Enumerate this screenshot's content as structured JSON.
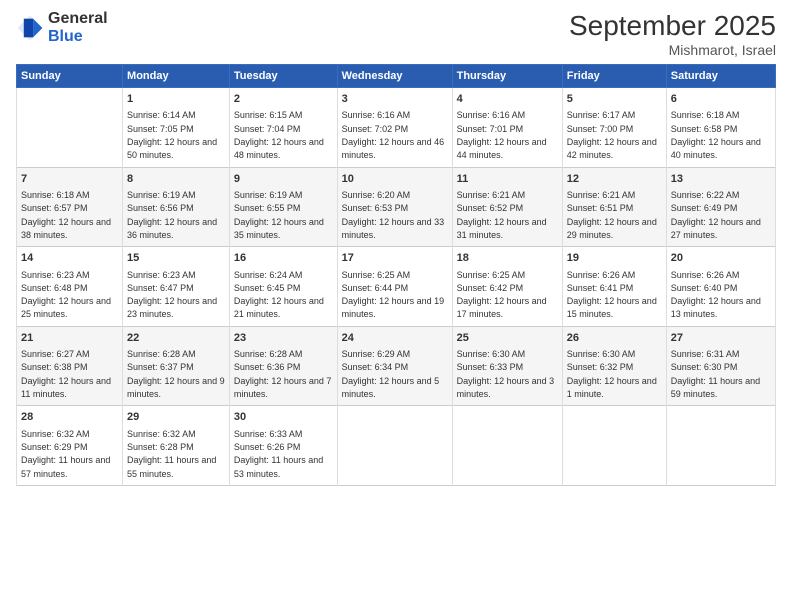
{
  "logo": {
    "general": "General",
    "blue": "Blue"
  },
  "header": {
    "title": "September 2025",
    "subtitle": "Mishmarot, Israel"
  },
  "weekdays": [
    "Sunday",
    "Monday",
    "Tuesday",
    "Wednesday",
    "Thursday",
    "Friday",
    "Saturday"
  ],
  "weeks": [
    [
      {
        "day": "",
        "sunrise": "",
        "sunset": "",
        "daylight": ""
      },
      {
        "day": "1",
        "sunrise": "Sunrise: 6:14 AM",
        "sunset": "Sunset: 7:05 PM",
        "daylight": "Daylight: 12 hours and 50 minutes."
      },
      {
        "day": "2",
        "sunrise": "Sunrise: 6:15 AM",
        "sunset": "Sunset: 7:04 PM",
        "daylight": "Daylight: 12 hours and 48 minutes."
      },
      {
        "day": "3",
        "sunrise": "Sunrise: 6:16 AM",
        "sunset": "Sunset: 7:02 PM",
        "daylight": "Daylight: 12 hours and 46 minutes."
      },
      {
        "day": "4",
        "sunrise": "Sunrise: 6:16 AM",
        "sunset": "Sunset: 7:01 PM",
        "daylight": "Daylight: 12 hours and 44 minutes."
      },
      {
        "day": "5",
        "sunrise": "Sunrise: 6:17 AM",
        "sunset": "Sunset: 7:00 PM",
        "daylight": "Daylight: 12 hours and 42 minutes."
      },
      {
        "day": "6",
        "sunrise": "Sunrise: 6:18 AM",
        "sunset": "Sunset: 6:58 PM",
        "daylight": "Daylight: 12 hours and 40 minutes."
      }
    ],
    [
      {
        "day": "7",
        "sunrise": "Sunrise: 6:18 AM",
        "sunset": "Sunset: 6:57 PM",
        "daylight": "Daylight: 12 hours and 38 minutes."
      },
      {
        "day": "8",
        "sunrise": "Sunrise: 6:19 AM",
        "sunset": "Sunset: 6:56 PM",
        "daylight": "Daylight: 12 hours and 36 minutes."
      },
      {
        "day": "9",
        "sunrise": "Sunrise: 6:19 AM",
        "sunset": "Sunset: 6:55 PM",
        "daylight": "Daylight: 12 hours and 35 minutes."
      },
      {
        "day": "10",
        "sunrise": "Sunrise: 6:20 AM",
        "sunset": "Sunset: 6:53 PM",
        "daylight": "Daylight: 12 hours and 33 minutes."
      },
      {
        "day": "11",
        "sunrise": "Sunrise: 6:21 AM",
        "sunset": "Sunset: 6:52 PM",
        "daylight": "Daylight: 12 hours and 31 minutes."
      },
      {
        "day": "12",
        "sunrise": "Sunrise: 6:21 AM",
        "sunset": "Sunset: 6:51 PM",
        "daylight": "Daylight: 12 hours and 29 minutes."
      },
      {
        "day": "13",
        "sunrise": "Sunrise: 6:22 AM",
        "sunset": "Sunset: 6:49 PM",
        "daylight": "Daylight: 12 hours and 27 minutes."
      }
    ],
    [
      {
        "day": "14",
        "sunrise": "Sunrise: 6:23 AM",
        "sunset": "Sunset: 6:48 PM",
        "daylight": "Daylight: 12 hours and 25 minutes."
      },
      {
        "day": "15",
        "sunrise": "Sunrise: 6:23 AM",
        "sunset": "Sunset: 6:47 PM",
        "daylight": "Daylight: 12 hours and 23 minutes."
      },
      {
        "day": "16",
        "sunrise": "Sunrise: 6:24 AM",
        "sunset": "Sunset: 6:45 PM",
        "daylight": "Daylight: 12 hours and 21 minutes."
      },
      {
        "day": "17",
        "sunrise": "Sunrise: 6:25 AM",
        "sunset": "Sunset: 6:44 PM",
        "daylight": "Daylight: 12 hours and 19 minutes."
      },
      {
        "day": "18",
        "sunrise": "Sunrise: 6:25 AM",
        "sunset": "Sunset: 6:42 PM",
        "daylight": "Daylight: 12 hours and 17 minutes."
      },
      {
        "day": "19",
        "sunrise": "Sunrise: 6:26 AM",
        "sunset": "Sunset: 6:41 PM",
        "daylight": "Daylight: 12 hours and 15 minutes."
      },
      {
        "day": "20",
        "sunrise": "Sunrise: 6:26 AM",
        "sunset": "Sunset: 6:40 PM",
        "daylight": "Daylight: 12 hours and 13 minutes."
      }
    ],
    [
      {
        "day": "21",
        "sunrise": "Sunrise: 6:27 AM",
        "sunset": "Sunset: 6:38 PM",
        "daylight": "Daylight: 12 hours and 11 minutes."
      },
      {
        "day": "22",
        "sunrise": "Sunrise: 6:28 AM",
        "sunset": "Sunset: 6:37 PM",
        "daylight": "Daylight: 12 hours and 9 minutes."
      },
      {
        "day": "23",
        "sunrise": "Sunrise: 6:28 AM",
        "sunset": "Sunset: 6:36 PM",
        "daylight": "Daylight: 12 hours and 7 minutes."
      },
      {
        "day": "24",
        "sunrise": "Sunrise: 6:29 AM",
        "sunset": "Sunset: 6:34 PM",
        "daylight": "Daylight: 12 hours and 5 minutes."
      },
      {
        "day": "25",
        "sunrise": "Sunrise: 6:30 AM",
        "sunset": "Sunset: 6:33 PM",
        "daylight": "Daylight: 12 hours and 3 minutes."
      },
      {
        "day": "26",
        "sunrise": "Sunrise: 6:30 AM",
        "sunset": "Sunset: 6:32 PM",
        "daylight": "Daylight: 12 hours and 1 minute."
      },
      {
        "day": "27",
        "sunrise": "Sunrise: 6:31 AM",
        "sunset": "Sunset: 6:30 PM",
        "daylight": "Daylight: 11 hours and 59 minutes."
      }
    ],
    [
      {
        "day": "28",
        "sunrise": "Sunrise: 6:32 AM",
        "sunset": "Sunset: 6:29 PM",
        "daylight": "Daylight: 11 hours and 57 minutes."
      },
      {
        "day": "29",
        "sunrise": "Sunrise: 6:32 AM",
        "sunset": "Sunset: 6:28 PM",
        "daylight": "Daylight: 11 hours and 55 minutes."
      },
      {
        "day": "30",
        "sunrise": "Sunrise: 6:33 AM",
        "sunset": "Sunset: 6:26 PM",
        "daylight": "Daylight: 11 hours and 53 minutes."
      },
      {
        "day": "",
        "sunrise": "",
        "sunset": "",
        "daylight": ""
      },
      {
        "day": "",
        "sunrise": "",
        "sunset": "",
        "daylight": ""
      },
      {
        "day": "",
        "sunrise": "",
        "sunset": "",
        "daylight": ""
      },
      {
        "day": "",
        "sunrise": "",
        "sunset": "",
        "daylight": ""
      }
    ]
  ]
}
